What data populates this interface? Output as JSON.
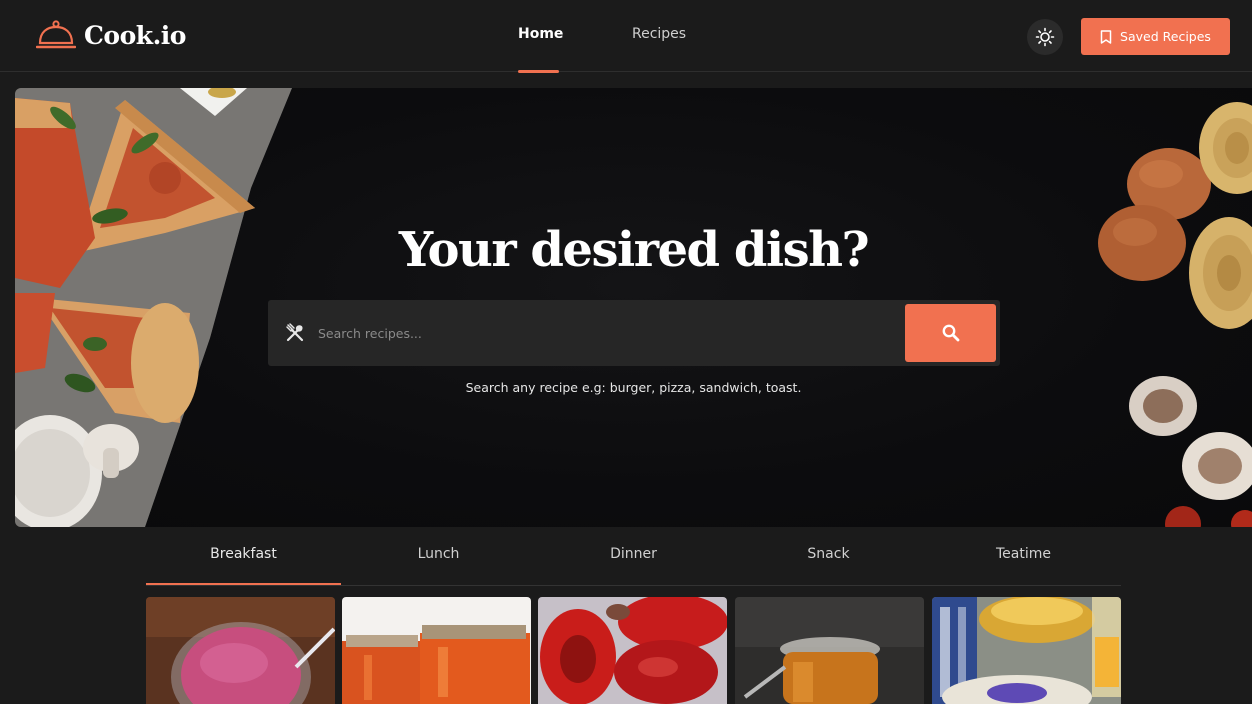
{
  "header": {
    "logo_text": "Cook.io",
    "nav": [
      {
        "label": "Home",
        "active": true
      },
      {
        "label": "Recipes",
        "active": false
      }
    ],
    "theme_toggle_icon": "sun-icon",
    "saved_button_label": "Saved Recipes",
    "saved_button_icon": "bookmark-icon"
  },
  "hero": {
    "title": "Your desired dish?",
    "search": {
      "placeholder": "Search recipes...",
      "value": "",
      "left_icon": "utensils-icon",
      "button_icon": "search-icon"
    },
    "hint": "Search any recipe e.g: burger, pizza, sandwich, toast."
  },
  "tabs": [
    {
      "label": "Breakfast",
      "active": true
    },
    {
      "label": "Lunch",
      "active": false
    },
    {
      "label": "Dinner",
      "active": false
    },
    {
      "label": "Snack",
      "active": false
    },
    {
      "label": "Teatime",
      "active": false
    }
  ],
  "colors": {
    "accent": "#f17150",
    "background": "#1b1b1b",
    "surface": "#262626"
  }
}
